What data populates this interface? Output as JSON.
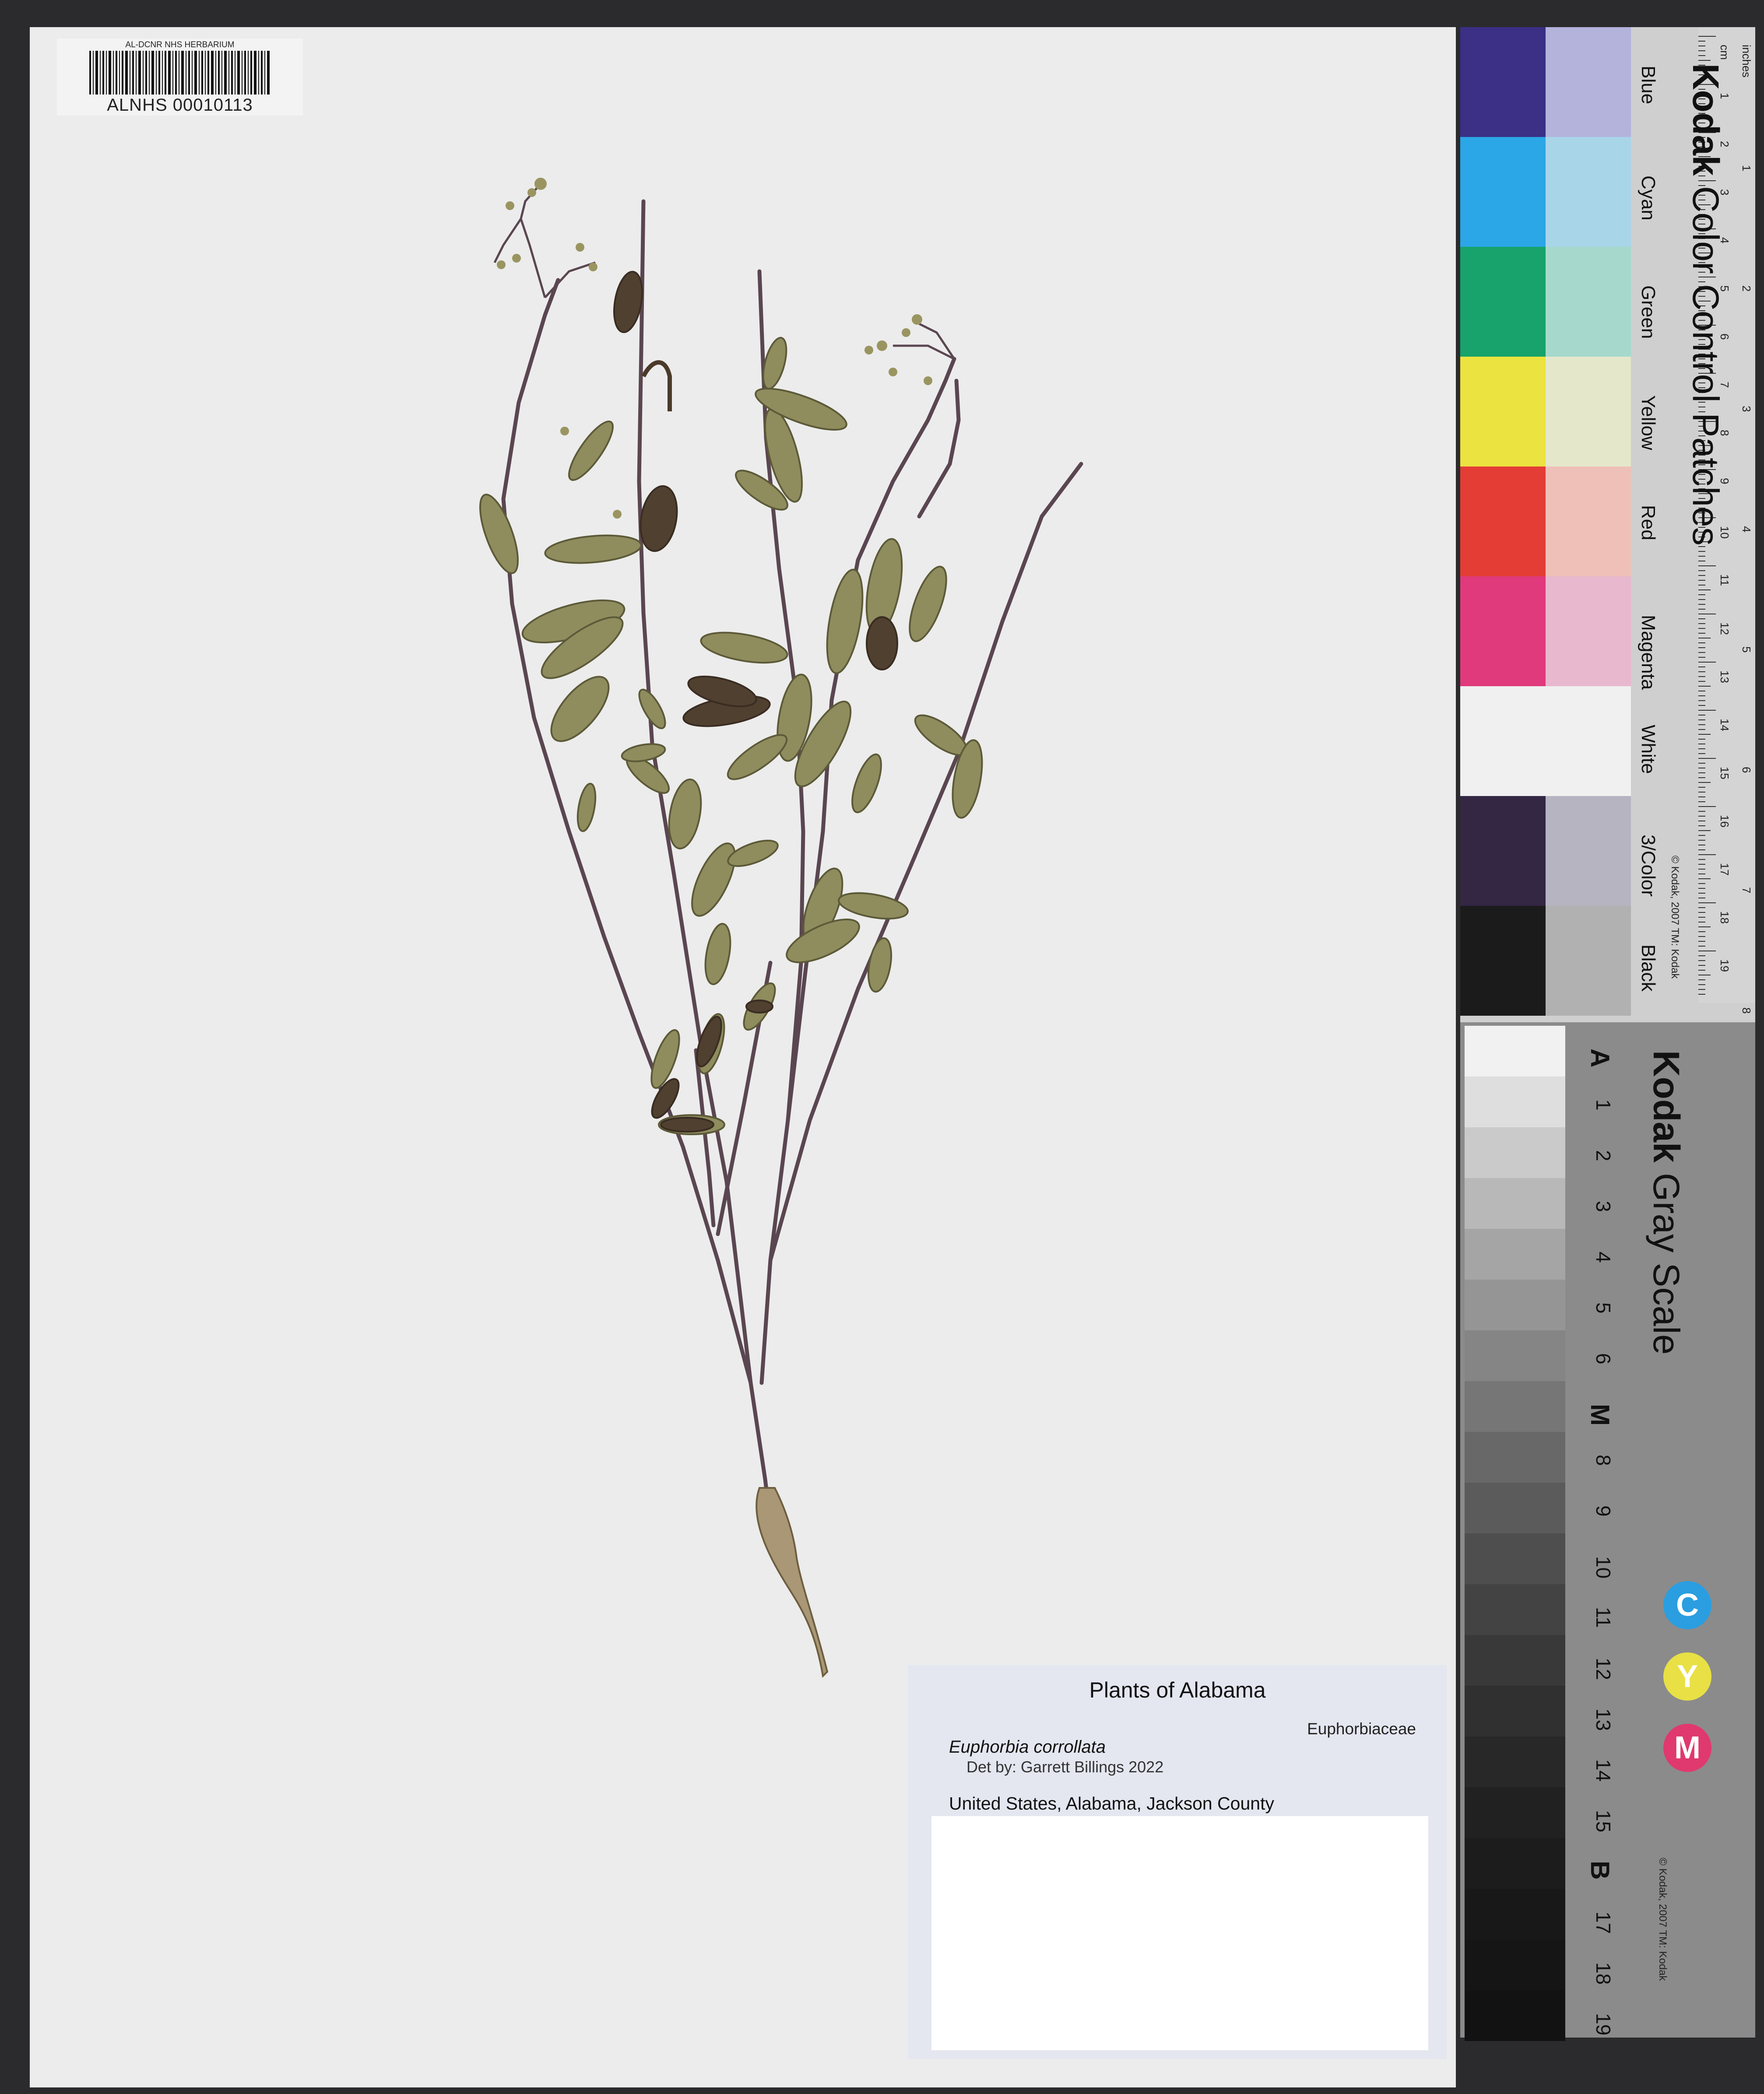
{
  "specimen": {
    "institution_tag": "AL-DCNR NHS HERBARIUM",
    "catalog_number": "ALNHS 00010113"
  },
  "label": {
    "title": "Plants of Alabama",
    "family": "Euphorbiaceae",
    "scientific_name": "Euphorbia corrollata",
    "determination": "Det by: Garrett Billings 2022",
    "locality": "United States, Alabama, Jackson County"
  },
  "color_chart": {
    "brand": "Kodak",
    "title": "Color Control Patches",
    "copyright": "© Kodak, 2007 TM: Kodak",
    "patch_names": [
      "Blue",
      "Cyan",
      "Green",
      "Yellow",
      "Red",
      "Magenta",
      "White",
      "3/Color",
      "Black"
    ],
    "patch_colors": [
      [
        "#3b2f86",
        "#b3b3dc"
      ],
      [
        "#2ba6e6",
        "#a9d5e8"
      ],
      [
        "#17a36b",
        "#a6d9cc"
      ],
      [
        "#ebe33f",
        "#e5e7cb"
      ],
      [
        "#e43d35",
        "#eec0b8"
      ],
      [
        "#e0397c",
        "#e8b8cf"
      ],
      [
        "#f0f0f0",
        "#f0f0f0"
      ],
      [
        "#332744",
        "#b6b4c0"
      ],
      [
        "#1b1b1b",
        "#b1b1b1"
      ]
    ],
    "ruler_cm": [
      "cm",
      "1",
      "2",
      "3",
      "4",
      "5",
      "6",
      "7",
      "8",
      "9",
      "10",
      "11",
      "12",
      "13",
      "14",
      "15",
      "16",
      "17",
      "18",
      "19"
    ],
    "ruler_inches": [
      "inches",
      "1",
      "2",
      "3",
      "4",
      "5",
      "6",
      "7",
      "8"
    ]
  },
  "gray_scale": {
    "brand": "Kodak",
    "title": "Gray Scale",
    "copyright": "© Kodak, 2007 TM: Kodak",
    "steps": [
      "A",
      "1",
      "2",
      "3",
      "4",
      "5",
      "6",
      "M",
      "8",
      "9",
      "10",
      "11",
      "12",
      "13",
      "14",
      "15",
      "B",
      "17",
      "18",
      "19"
    ],
    "cym": [
      "C",
      "Y",
      "M"
    ],
    "cym_colors": [
      "#2a9ee0",
      "#e8e045",
      "#e0396f"
    ]
  }
}
